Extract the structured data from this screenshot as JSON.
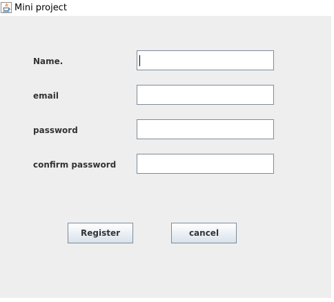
{
  "window": {
    "title": "Mini project",
    "icon": "java-icon"
  },
  "form": {
    "name_label": "Name.",
    "email_label": "email",
    "password_label": "password",
    "confirm_password_label": "confirm password",
    "name_value": "",
    "email_value": "",
    "password_value": "",
    "confirm_password_value": ""
  },
  "buttons": {
    "register_label": "Register",
    "cancel_label": "cancel"
  }
}
